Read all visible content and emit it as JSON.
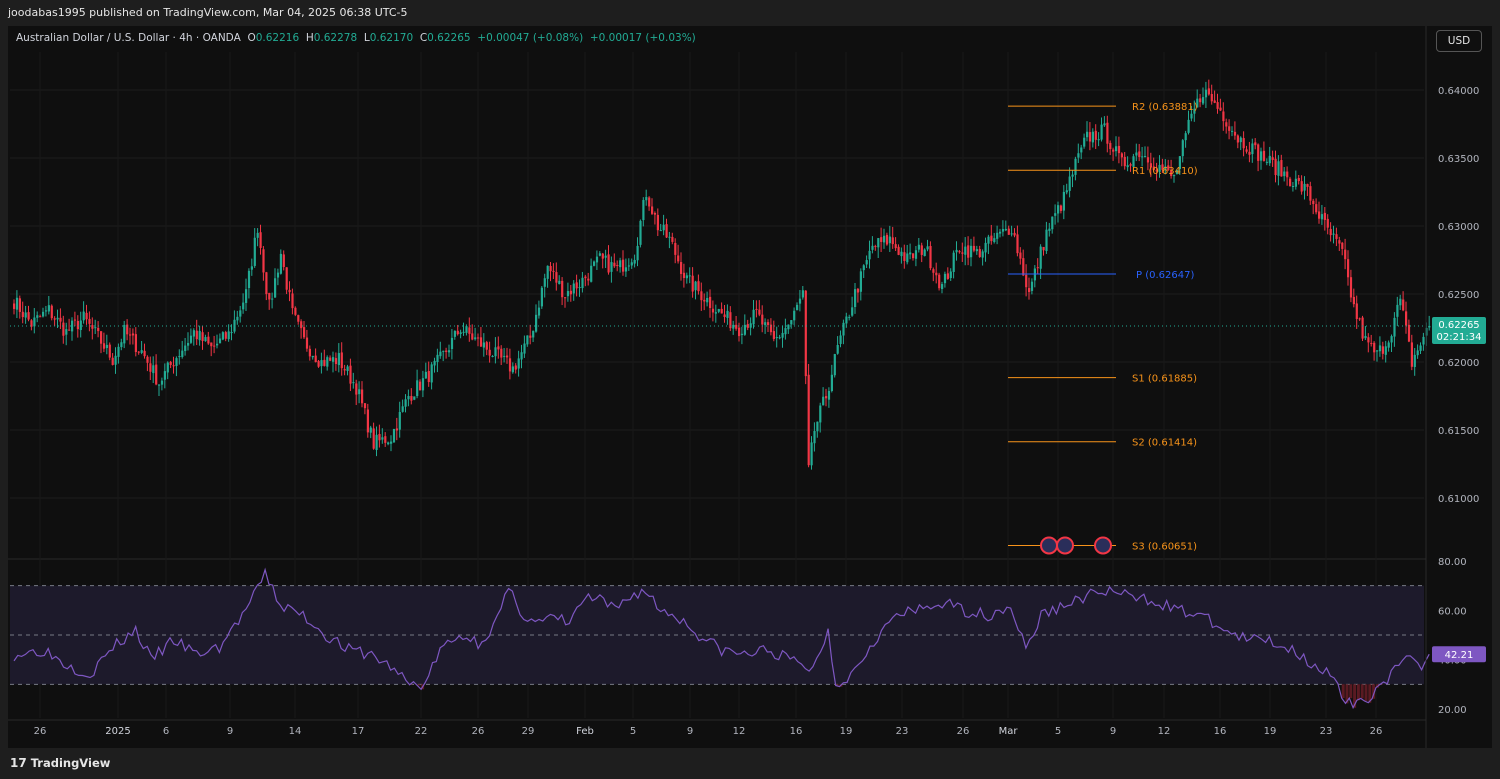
{
  "header": {
    "published": "joodabas1995 published on TradingView.com, Mar 04, 2025 06:38 UTC-5"
  },
  "legend": {
    "symbol": "Australian Dollar / U.S. Dollar · 4h · OANDA",
    "o_label": "O",
    "o_val": "0.62216",
    "h_label": "H",
    "h_val": "0.62278",
    "l_label": "L",
    "l_val": "0.62170",
    "c_label": "C",
    "c_val": "0.62265",
    "change": "+0.00047 (+0.08%)",
    "change2": "+0.00017 (+0.03%)"
  },
  "currency_button": "USD",
  "footer": {
    "brand": "TradingView",
    "logo": "17"
  },
  "colors": {
    "up": "#22ab94",
    "down": "#f23645",
    "pivot_orange": "#f7931a",
    "pivot_blue": "#2962ff",
    "rsi_line": "#7e57c2",
    "rsi_band": "#1d1a2b",
    "price_tag": "#22ab94",
    "rsi_tag": "#7e57c2",
    "oversold_fill": "#5a1a22"
  },
  "chart_data": [
    {
      "type": "candlestick",
      "title": "",
      "ylim": [
        0.6055,
        0.6415
      ],
      "yticks": [
        "0.64000",
        "0.63500",
        "0.63000",
        "0.62500",
        "0.62000",
        "0.61500",
        "0.61000"
      ],
      "xticks": [
        "26",
        "2025",
        "6",
        "9",
        "14",
        "17",
        "22",
        "26",
        "29",
        "Feb",
        "5",
        "9",
        "12",
        "16",
        "19",
        "23",
        "26",
        "Mar",
        "5",
        "9",
        "12",
        "16",
        "19",
        "23",
        "26"
      ],
      "last_price": "0.62265",
      "countdown": "02:21:34",
      "path": [
        [
          0,
          0.6245
        ],
        [
          6,
          0.6228
        ],
        [
          12,
          0.6238
        ],
        [
          18,
          0.6222
        ],
        [
          24,
          0.6232
        ],
        [
          30,
          0.6215
        ],
        [
          34,
          0.6202
        ],
        [
          38,
          0.6222
        ],
        [
          44,
          0.6208
        ],
        [
          50,
          0.6185
        ],
        [
          56,
          0.6204
        ],
        [
          62,
          0.6222
        ],
        [
          68,
          0.621
        ],
        [
          74,
          0.622
        ],
        [
          80,
          0.625
        ],
        [
          84,
          0.63
        ],
        [
          88,
          0.624
        ],
        [
          92,
          0.628
        ],
        [
          96,
          0.6235
        ],
        [
          100,
          0.6215
        ],
        [
          106,
          0.62
        ],
        [
          112,
          0.6202
        ],
        [
          118,
          0.6182
        ],
        [
          124,
          0.614
        ],
        [
          130,
          0.6145
        ],
        [
          136,
          0.6175
        ],
        [
          142,
          0.6188
        ],
        [
          148,
          0.6205
        ],
        [
          154,
          0.6225
        ],
        [
          160,
          0.6215
        ],
        [
          166,
          0.6205
        ],
        [
          172,
          0.6195
        ],
        [
          178,
          0.6218
        ],
        [
          184,
          0.627
        ],
        [
          190,
          0.625
        ],
        [
          196,
          0.626
        ],
        [
          202,
          0.6275
        ],
        [
          208,
          0.6268
        ],
        [
          214,
          0.628
        ],
        [
          218,
          0.6325
        ],
        [
          222,
          0.63
        ],
        [
          226,
          0.629
        ],
        [
          232,
          0.626
        ],
        [
          238,
          0.6248
        ],
        [
          244,
          0.6235
        ],
        [
          250,
          0.6225
        ],
        [
          256,
          0.6235
        ],
        [
          262,
          0.6215
        ],
        [
          268,
          0.623
        ],
        [
          272,
          0.625
        ],
        [
          274,
          0.612
        ],
        [
          276,
          0.615
        ],
        [
          280,
          0.6175
        ],
        [
          284,
          0.621
        ],
        [
          290,
          0.625
        ],
        [
          296,
          0.6285
        ],
        [
          302,
          0.629
        ],
        [
          308,
          0.6275
        ],
        [
          314,
          0.6285
        ],
        [
          320,
          0.6255
        ],
        [
          326,
          0.6285
        ],
        [
          332,
          0.628
        ],
        [
          338,
          0.629
        ],
        [
          344,
          0.63
        ],
        [
          350,
          0.625
        ],
        [
          356,
          0.6295
        ],
        [
          362,
          0.632
        ],
        [
          366,
          0.6345
        ],
        [
          370,
          0.6365
        ],
        [
          376,
          0.637
        ],
        [
          382,
          0.6345
        ],
        [
          388,
          0.6355
        ],
        [
          394,
          0.6345
        ],
        [
          400,
          0.6335
        ],
        [
          406,
          0.638
        ],
        [
          410,
          0.64
        ],
        [
          416,
          0.6385
        ],
        [
          422,
          0.6365
        ],
        [
          428,
          0.6355
        ],
        [
          434,
          0.6345
        ],
        [
          440,
          0.6335
        ],
        [
          446,
          0.6325
        ],
        [
          452,
          0.63
        ],
        [
          458,
          0.628
        ],
        [
          462,
          0.624
        ],
        [
          466,
          0.6215
        ],
        [
          470,
          0.6205
        ],
        [
          474,
          0.6218
        ],
        [
          478,
          0.6245
        ],
        [
          482,
          0.62
        ],
        [
          486,
          0.6218
        ],
        [
          488,
          0.6226
        ]
      ],
      "series": [
        {
          "name": "R2 (0.63881)",
          "value": 0.63881,
          "color": "pivot_orange"
        },
        {
          "name": "R1 (0.63410)",
          "value": 0.6341,
          "color": "pivot_orange"
        },
        {
          "name": "P (0.62647)",
          "value": 0.62647,
          "color": "pivot_blue"
        },
        {
          "name": "S1 (0.61885)",
          "value": 0.61885,
          "color": "pivot_orange"
        },
        {
          "name": "S2 (0.61414)",
          "value": 0.61414,
          "color": "pivot_orange"
        },
        {
          "name": "S3 (0.60651)",
          "value": 0.60651,
          "color": "pivot_orange"
        }
      ]
    },
    {
      "type": "line",
      "title": "",
      "ylim": [
        15,
        80
      ],
      "yticks": [
        "80.00",
        "60.00",
        "40.00",
        "20.00"
      ],
      "bands": [
        70,
        50,
        30
      ],
      "last_value": "42.21",
      "values": [
        [
          0,
          42
        ],
        [
          8,
          44
        ],
        [
          14,
          38
        ],
        [
          20,
          34
        ],
        [
          26,
          45
        ],
        [
          32,
          52
        ],
        [
          36,
          40
        ],
        [
          42,
          48
        ],
        [
          48,
          42
        ],
        [
          54,
          45
        ],
        [
          60,
          58
        ],
        [
          64,
          68
        ],
        [
          66,
          75
        ],
        [
          70,
          62
        ],
        [
          76,
          58
        ],
        [
          82,
          50
        ],
        [
          88,
          44
        ],
        [
          94,
          42
        ],
        [
          100,
          36
        ],
        [
          104,
          30
        ],
        [
          108,
          30
        ],
        [
          112,
          44
        ],
        [
          118,
          50
        ],
        [
          122,
          47
        ],
        [
          126,
          53
        ],
        [
          130,
          68
        ],
        [
          134,
          58
        ],
        [
          138,
          55
        ],
        [
          142,
          57
        ],
        [
          146,
          55
        ],
        [
          150,
          65
        ],
        [
          154,
          64
        ],
        [
          158,
          60
        ],
        [
          162,
          66
        ],
        [
          166,
          68
        ],
        [
          170,
          60
        ],
        [
          174,
          58
        ],
        [
          180,
          50
        ],
        [
          186,
          44
        ],
        [
          192,
          42
        ],
        [
          198,
          44
        ],
        [
          204,
          40
        ],
        [
          210,
          36
        ],
        [
          214,
          52
        ],
        [
          216,
          30
        ],
        [
          220,
          34
        ],
        [
          226,
          48
        ],
        [
          232,
          58
        ],
        [
          238,
          60
        ],
        [
          244,
          63
        ],
        [
          250,
          60
        ],
        [
          256,
          58
        ],
        [
          262,
          62
        ],
        [
          266,
          44
        ],
        [
          270,
          58
        ],
        [
          276,
          62
        ],
        [
          282,
          66
        ],
        [
          288,
          68
        ],
        [
          294,
          65
        ],
        [
          300,
          64
        ],
        [
          306,
          60
        ],
        [
          312,
          58
        ],
        [
          318,
          52
        ],
        [
          324,
          48
        ],
        [
          330,
          48
        ],
        [
          336,
          44
        ],
        [
          342,
          38
        ],
        [
          346,
          34
        ],
        [
          350,
          22
        ],
        [
          354,
          22
        ],
        [
          358,
          28
        ],
        [
          362,
          34
        ],
        [
          366,
          40
        ],
        [
          370,
          38
        ],
        [
          372,
          42
        ]
      ]
    }
  ]
}
